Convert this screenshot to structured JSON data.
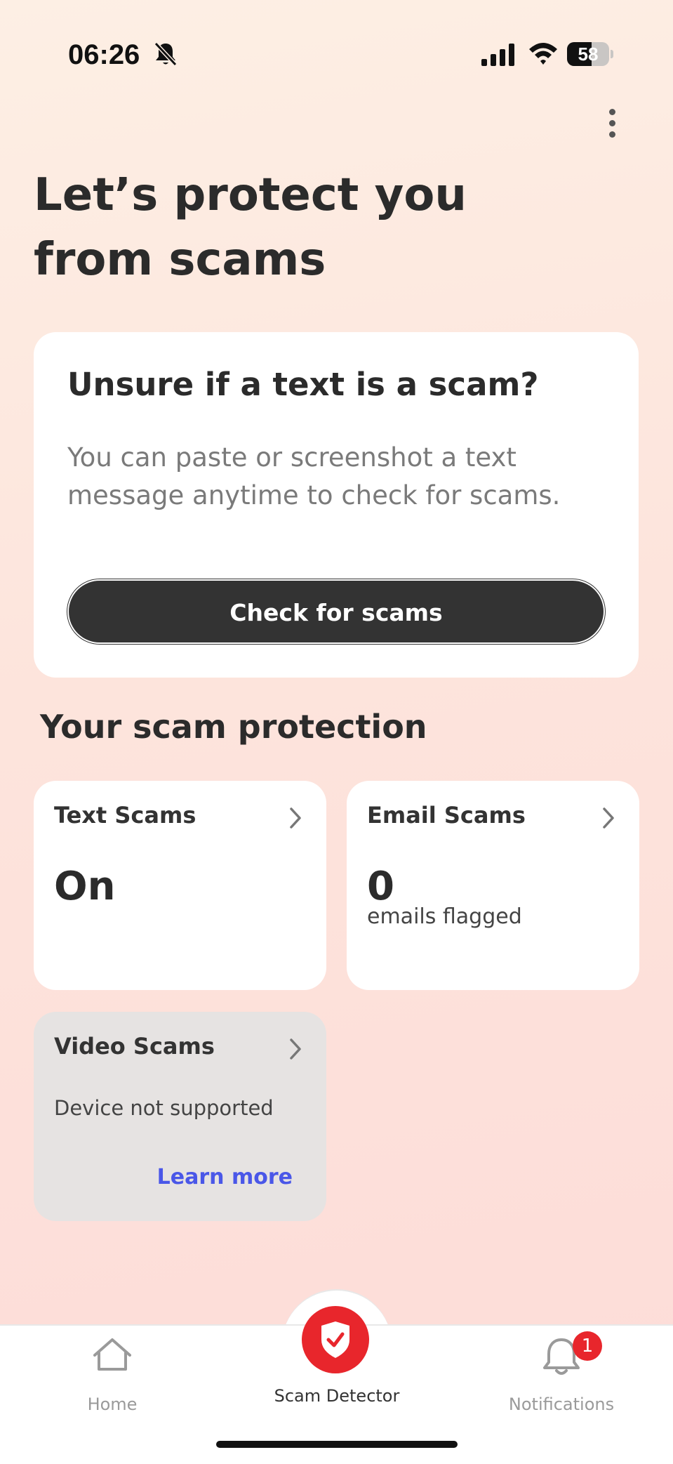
{
  "status_bar": {
    "time": "06:26",
    "battery_percent": "58",
    "battery_level": 0.58,
    "icons": [
      "bell-muted-icon",
      "signal-icon",
      "wifi-icon",
      "battery-icon"
    ]
  },
  "header": {
    "more_icon": "vertical-ellipsis-icon",
    "title": "Let’s protect you from scams"
  },
  "check_card": {
    "heading": "Unsure if a text is a scam?",
    "description": "You can paste or screenshot a text message anytime to check for scams.",
    "button_label": "Check for scams"
  },
  "protection": {
    "section_title": "Your scam protection",
    "text_scams": {
      "title": "Text Scams",
      "status": "On"
    },
    "email_scams": {
      "title": "Email Scams",
      "count": "0",
      "caption": "emails flagged"
    },
    "video_scams": {
      "title": "Video Scams",
      "status": "Device not supported",
      "link": "Learn more"
    }
  },
  "tabbar": {
    "home": {
      "label": "Home",
      "icon": "home-icon"
    },
    "scam_detector": {
      "label": "Scam Detector",
      "icon": "shield-check-icon"
    },
    "notifications": {
      "label": "Notifications",
      "icon": "bell-icon",
      "badge": "1"
    }
  },
  "colors": {
    "accent": "#e8262c",
    "link": "#4a57e8",
    "button_bg": "#333333"
  }
}
